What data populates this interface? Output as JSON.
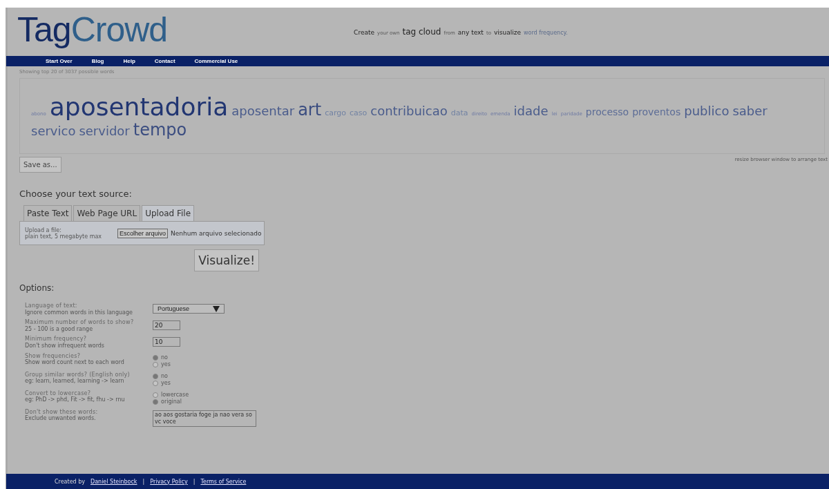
{
  "logo": {
    "part_1": "Tag",
    "part_2": "Crowd"
  },
  "tagline": [
    {
      "text": "Create",
      "kind": "medium"
    },
    {
      "text": "your own",
      "kind": "tiny"
    },
    {
      "text": "tag cloud",
      "kind": "large"
    },
    {
      "text": "from",
      "kind": "tiny"
    },
    {
      "text": "any text",
      "kind": "medium"
    },
    {
      "text": "to",
      "kind": "tiny"
    },
    {
      "text": "visualize",
      "kind": "medium"
    },
    {
      "text": "word frequency.",
      "kind": "small"
    }
  ],
  "nav": [
    "Start Over",
    "Blog",
    "Help",
    "Contact",
    "Commercial Use"
  ],
  "cloud_caption": "Showing top 20 of 3037 possible words",
  "tags": [
    {
      "text": "abono",
      "kind": "tiny"
    },
    {
      "text": "aposentadoria",
      "kind": "giant"
    },
    {
      "text": "aposentar",
      "kind": "large"
    },
    {
      "text": "art",
      "kind": "huge"
    },
    {
      "text": "cargo",
      "kind": "small"
    },
    {
      "text": "caso",
      "kind": "small"
    },
    {
      "text": "contribuicao",
      "kind": "large"
    },
    {
      "text": "data",
      "kind": "small"
    },
    {
      "text": "direito",
      "kind": "tiny"
    },
    {
      "text": "emenda",
      "kind": "tiny"
    },
    {
      "text": "idade",
      "kind": "large"
    },
    {
      "text": "lei",
      "kind": "tiny"
    },
    {
      "text": "paridade",
      "kind": "tiny"
    },
    {
      "text": "processo",
      "kind": "medium"
    },
    {
      "text": "proventos",
      "kind": "medium"
    },
    {
      "text": "publico",
      "kind": "large"
    },
    {
      "text": "saber",
      "kind": "large"
    },
    {
      "text": "servico",
      "kind": "large"
    },
    {
      "text": "servidor",
      "kind": "large"
    },
    {
      "text": "tempo",
      "kind": "huge"
    }
  ],
  "resize_hint": "resize browser window to arrange text",
  "save_button": "Save as...",
  "source_heading": "Choose your text source:",
  "source_tabs": [
    {
      "label": "Paste Text",
      "selected": false
    },
    {
      "label": "Web Page URL",
      "selected": false
    },
    {
      "label": "Upload File",
      "selected": true
    }
  ],
  "upload": {
    "label": "Upload a file:",
    "hint": "plain text, 5 megabyte max",
    "button": "Escolher arquivo",
    "status": "Nenhum arquivo selecionado"
  },
  "visualize_button": "Visualize!",
  "options_heading": "Options:",
  "options": [
    {
      "kind": "select",
      "label": "Language of text:",
      "hint": "Ignore common words in this language",
      "value": "Portuguese"
    },
    {
      "kind": "text",
      "label": "Maximum number of words to show?",
      "hint": "25 - 100 is a good range",
      "value": "20"
    },
    {
      "kind": "text",
      "label": "Minimum frequency?",
      "hint": "Don't show infrequent words",
      "value": "10"
    },
    {
      "kind": "radio",
      "label": "Show frequencies?",
      "hint": "Show word count next to each word",
      "choices": [
        {
          "label": "no",
          "selected": true
        },
        {
          "label": "yes",
          "selected": false
        }
      ]
    },
    {
      "kind": "radio",
      "label": "Group similar words? (English only)",
      "hint": "eg: learn, learned, learning -> learn",
      "choices": [
        {
          "label": "no",
          "selected": true
        },
        {
          "label": "yes",
          "selected": false
        }
      ]
    },
    {
      "kind": "radio",
      "label": "Convert to lowercase?",
      "hint": "eg: PhD -> phd, Fit -> fit, fhu -> rnu",
      "choices": [
        {
          "label": "lowercase",
          "selected": false
        },
        {
          "label": "original",
          "selected": true
        }
      ]
    },
    {
      "kind": "textarea",
      "label": "Don't show these words:",
      "hint": "Exclude unwanted words.",
      "value": "ao aos gostaria foge ja nao vera so vc voce"
    }
  ],
  "footer": [
    {
      "prefix": "Created by",
      "link": "Daniel Steinbock"
    },
    {
      "link": "Privacy Policy"
    },
    {
      "link": "Terms of Service"
    }
  ],
  "footer_separator": "|"
}
